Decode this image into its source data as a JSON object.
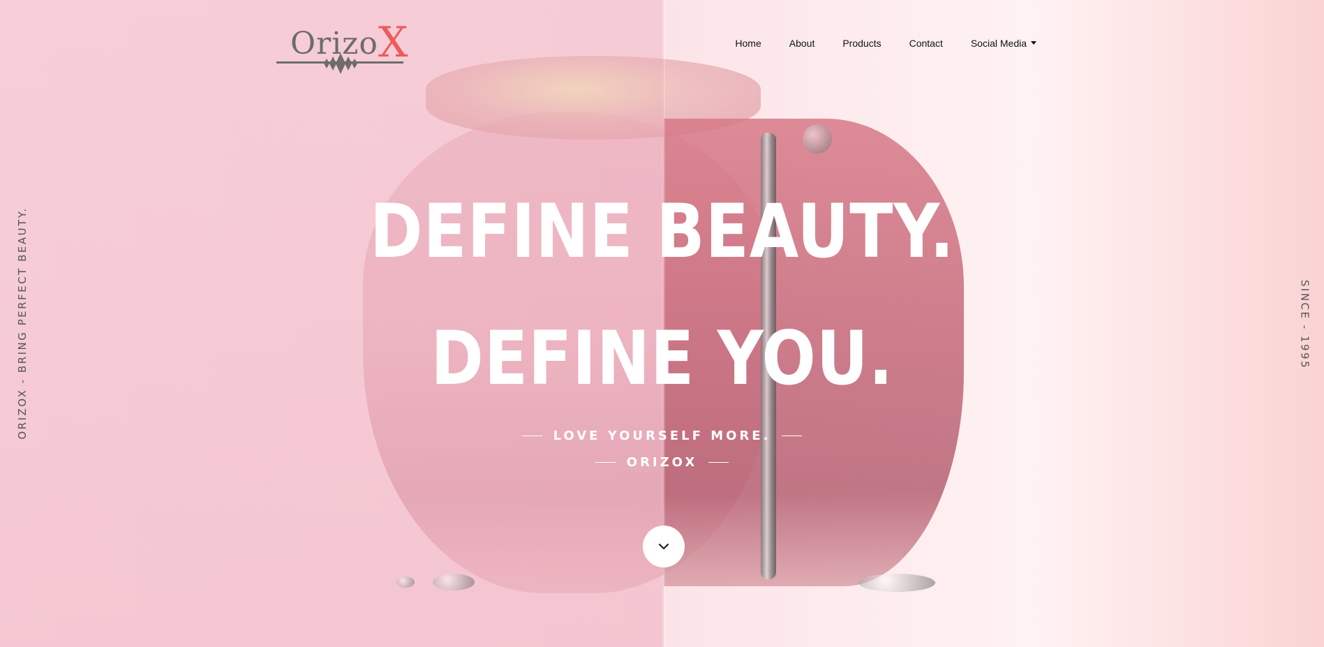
{
  "brand": {
    "logo_text": "Orizo",
    "logo_accent": "X",
    "logo_color": "#6c6c6c",
    "accent_color": "#ec5b5b"
  },
  "nav": {
    "items": [
      {
        "label": "Home"
      },
      {
        "label": "About"
      },
      {
        "label": "Products"
      },
      {
        "label": "Contact"
      },
      {
        "label": "Social Media"
      }
    ],
    "dropdown_icon": "caret-down-icon"
  },
  "side": {
    "left_text": "ORIZOX - BRING PERFECT BEAUTY.",
    "right_text": "SINCE - 1995"
  },
  "hero": {
    "headline_1": "DEFINE BEAUTY.",
    "headline_2": "DEFINE YOU.",
    "tagline": "LOVE YOURSELF MORE.",
    "subtag": "ORIZOX",
    "scroll_icon": "chevron-down-icon"
  }
}
